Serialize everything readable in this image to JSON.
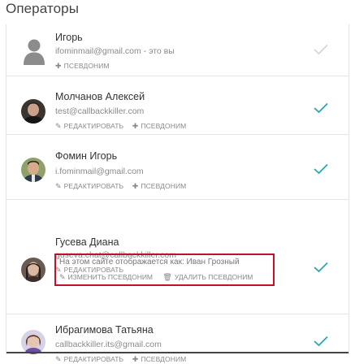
{
  "page_title": "Операторы",
  "colors": {
    "accent": "#2ba7b0",
    "muted_check": "#d6d6d6",
    "highlight_border": "#c0112b"
  },
  "operators": [
    {
      "name": "Игорь",
      "email": "ifominmail@gmail.com - это вы",
      "avatar": "user-placeholder-icon",
      "actions": [
        {
          "icon": "plus-icon",
          "label": "ПСЕВДОНИМ"
        }
      ],
      "check_state": "muted"
    },
    {
      "name": "Молчанов Алексей",
      "email": "test@callbackkiller.com",
      "avatar": "photo",
      "actions": [
        {
          "icon": "edit-icon",
          "label": "РЕДАКТИРОВАТЬ"
        },
        {
          "icon": "plus-icon",
          "label": "ПСЕВДОНИМ"
        }
      ],
      "check_state": "active"
    },
    {
      "name": "Фомин Игорь",
      "email": "i.fominmail@gmail.com",
      "avatar": "photo",
      "actions": [
        {
          "icon": "edit-icon",
          "label": "РЕДАКТИРОВАТЬ"
        },
        {
          "icon": "plus-icon",
          "label": "ПСЕВДОНИМ"
        }
      ],
      "check_state": "active"
    },
    {
      "name": "Гусева Диана",
      "email": "guseva.chat@callbackkiller.com",
      "avatar": "photo",
      "actions": [
        {
          "icon": "edit-icon",
          "label": "РЕДАКТИРОВАТЬ"
        }
      ],
      "alias": {
        "text": "На этом сайте отображается как: Иван Грозный",
        "actions": [
          {
            "icon": "edit-icon",
            "label": "ИЗМЕНИТЬ ПСЕВДОНИМ"
          },
          {
            "icon": "trash-icon",
            "label": "УДАЛИТЬ ПСЕВДОНИМ"
          }
        ]
      },
      "check_state": "active"
    },
    {
      "name": "Ибрагимова Татьяна",
      "email": "callbackkiller.its@gmail.com",
      "avatar": "photo",
      "actions": [
        {
          "icon": "edit-icon",
          "label": "РЕДАКТИРОВАТЬ"
        },
        {
          "icon": "plus-icon",
          "label": "ПСЕВДОНИМ"
        }
      ],
      "check_state": "active"
    }
  ]
}
